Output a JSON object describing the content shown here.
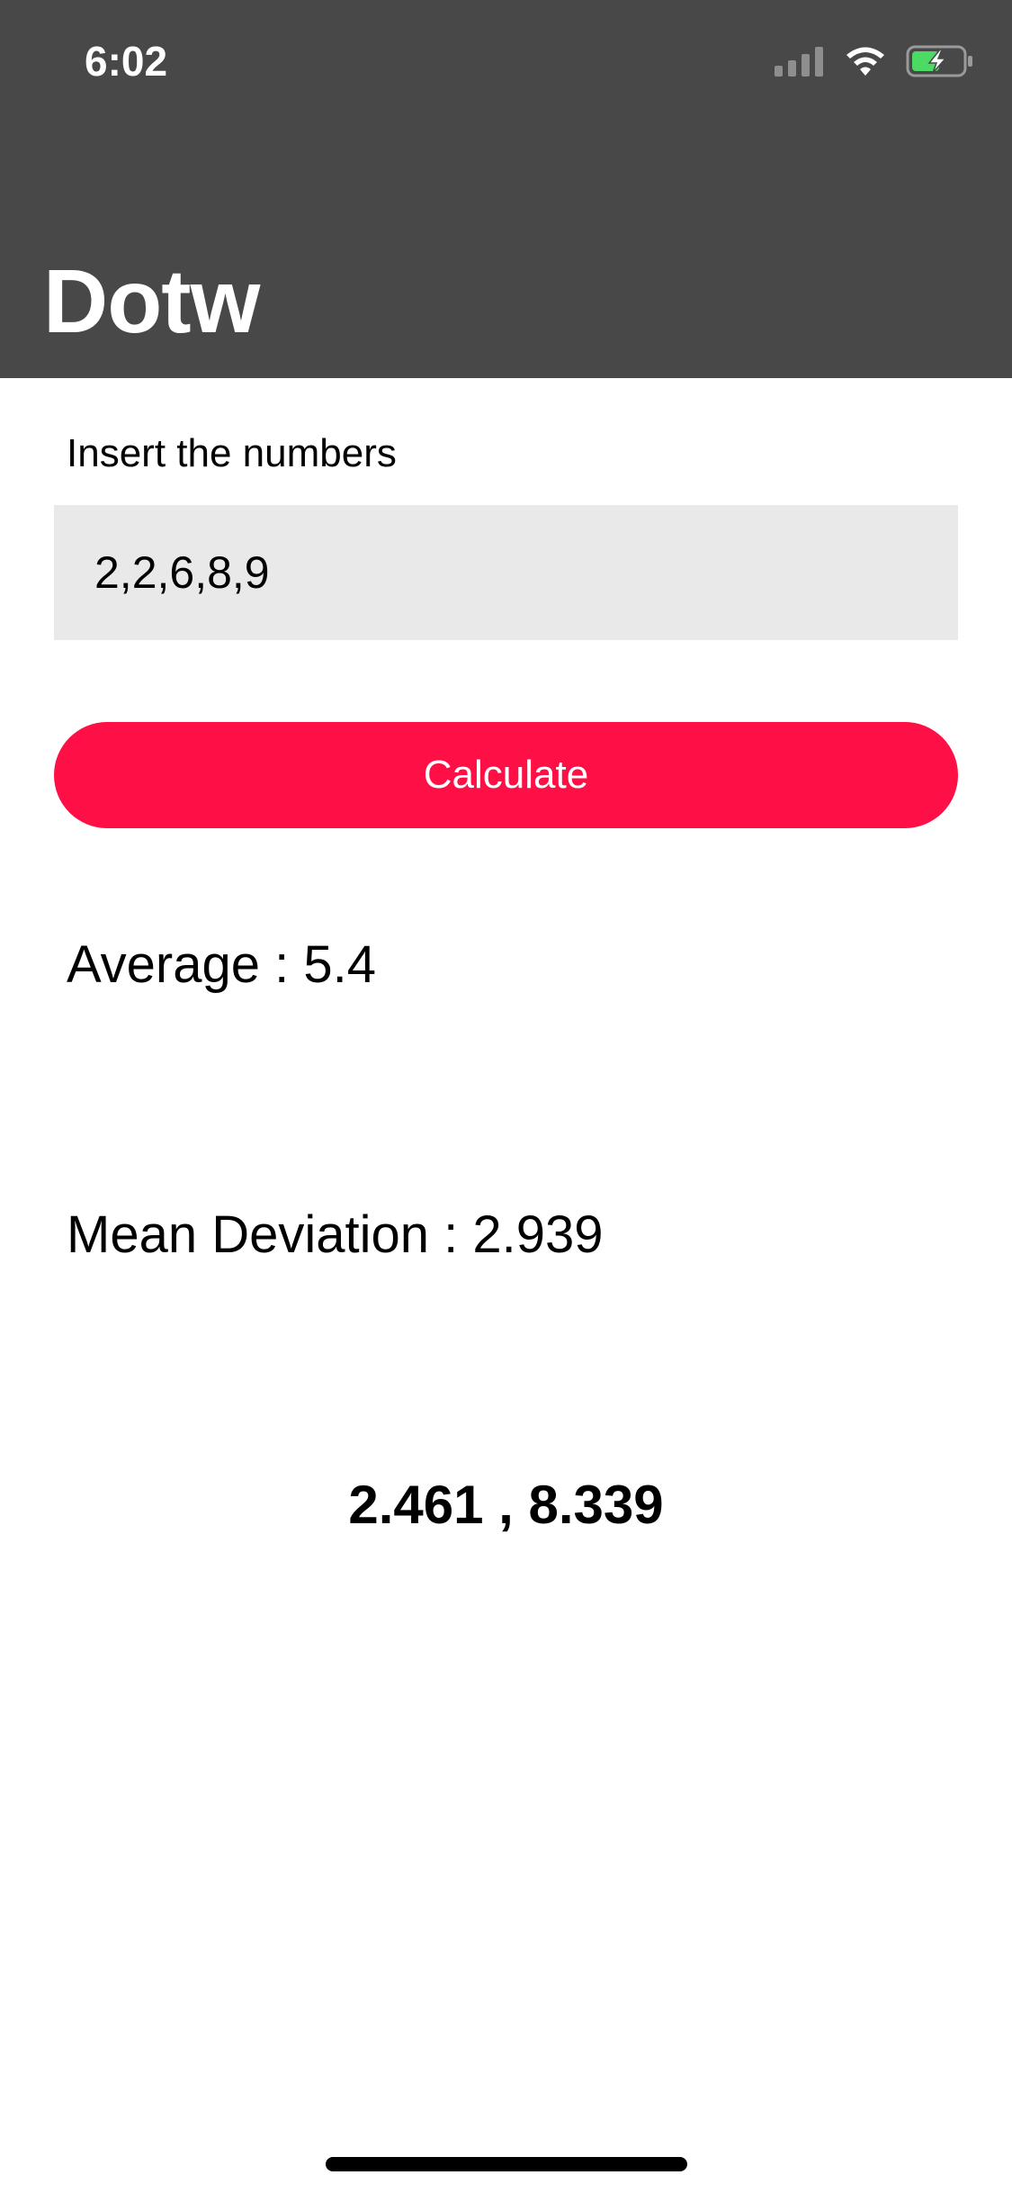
{
  "status_bar": {
    "time": "6:02",
    "icons": [
      "cellular-signal-icon",
      "wifi-icon",
      "battery-charging-icon"
    ]
  },
  "header": {
    "title": "Dotw",
    "background_color": "#484848"
  },
  "form": {
    "label": "Insert the numbers",
    "input_value": "2,2,6,8,9",
    "button_label": "Calculate",
    "button_color": "#FE1046"
  },
  "results": {
    "average": "Average : 5.4",
    "mean_deviation": "Mean Deviation : 2.939",
    "range": "2.461 , 8.339"
  }
}
